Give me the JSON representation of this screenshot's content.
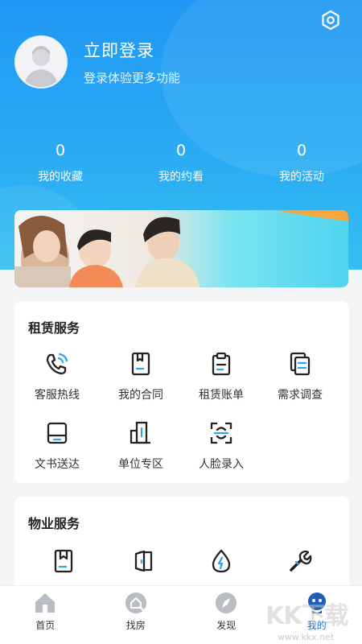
{
  "profile": {
    "login_title": "立即登录",
    "login_subtitle": "登录体验更多功能"
  },
  "stats": [
    {
      "value": "0",
      "label": "我的收藏"
    },
    {
      "value": "0",
      "label": "我的约看"
    },
    {
      "value": "0",
      "label": "我的活动"
    }
  ],
  "rental_services": {
    "title": "租赁服务",
    "items": [
      {
        "label": "客服热线",
        "icon": "phone-icon"
      },
      {
        "label": "我的合同",
        "icon": "contract-icon"
      },
      {
        "label": "租赁账单",
        "icon": "bill-icon"
      },
      {
        "label": "需求调查",
        "icon": "survey-icon"
      },
      {
        "label": "文书送达",
        "icon": "document-icon"
      },
      {
        "label": "单位专区",
        "icon": "building-icon"
      },
      {
        "label": "人脸录入",
        "icon": "face-scan-icon"
      }
    ]
  },
  "property_services": {
    "title": "物业服务",
    "items": [
      {
        "icon": "bookmark-icon"
      },
      {
        "icon": "door-icon"
      },
      {
        "icon": "water-electric-icon"
      },
      {
        "icon": "wrench-icon"
      }
    ]
  },
  "tabbar": [
    {
      "label": "首页",
      "icon": "home-icon"
    },
    {
      "label": "找房",
      "icon": "find-house-icon"
    },
    {
      "label": "发现",
      "icon": "compass-icon"
    },
    {
      "label": "我的",
      "icon": "profile-icon",
      "active": true
    }
  ],
  "watermark": {
    "text": "KK下载",
    "url": "www.kkx.net"
  },
  "colors": {
    "primary": "#1f98f5",
    "accent": "#1a6fd1",
    "icon_dark": "#222222",
    "icon_accent": "#2aa6f0"
  }
}
